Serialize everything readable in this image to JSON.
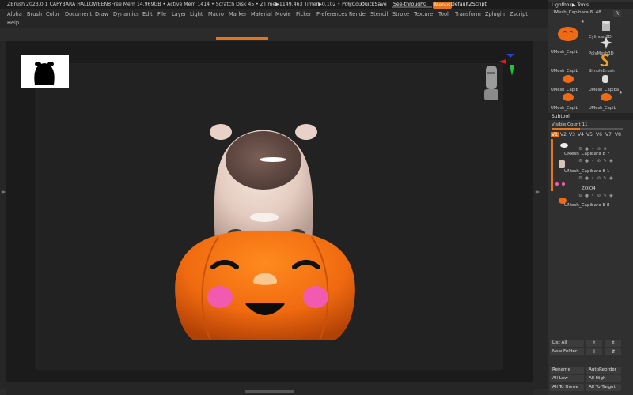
{
  "titlebar": {
    "app_title": "ZBrush 2023.0.1 CAPYBARA HALLOWEEN3",
    "mem_stats": "• Free Mem 14.969GB • Active Mem 1414 • Scratch Disk 45 • ZTime▶1149.463 Timer▶0.102 • PolyCour",
    "ac": "AC",
    "quicksave": "QuickSave",
    "seethrough_label": "See-through",
    "seethrough_value": "0",
    "seethrough_level": 0,
    "menus": "Menus",
    "default_script": "DefaultZScript"
  },
  "menu": {
    "row1": [
      "Alpha",
      "Brush",
      "Color",
      "Document",
      "Draw",
      "Dynamics",
      "Edit",
      "File",
      "Layer",
      "Light",
      "Macro",
      "Marker",
      "Material",
      "Movie",
      "Picker",
      "Preferences",
      "Render",
      "Stencil",
      "Stroke",
      "Texture",
      "Tool",
      "Transform",
      "Zplugin",
      "Zscript"
    ],
    "help": "Help"
  },
  "colors": {
    "accent": "#e8741a",
    "panel": "#303030",
    "viewport": "#1b1b1b",
    "canvas": "#222222"
  },
  "lightbox": {
    "label": "Lightbox▶ Tools"
  },
  "current_tool": {
    "name": "UMesh_Capibara 8. 48",
    "button": "R"
  },
  "tools": [
    {
      "name": "UMesh_Capib",
      "badge": "4"
    },
    {
      "name": "Cylinder3D",
      "badge": ""
    },
    {
      "name": "PolyMesh3D",
      "badge": ""
    },
    {
      "name": "UMesh_Capib",
      "badge": ""
    },
    {
      "name": "SimpleBrush",
      "badge": ""
    },
    {
      "name": "UMesh_Capib",
      "badge": ""
    },
    {
      "name": "UMesh_Capiba",
      "badge": ""
    },
    {
      "name": "UMesh_Capib",
      "badge": ""
    },
    {
      "name": "UMesh_Capib",
      "badge": "4"
    }
  ],
  "subtool": {
    "header": "Subtool",
    "visible_count": "Visible Count 11",
    "visible_tabs": [
      "V1",
      "V2",
      "V3",
      "V4",
      "V5",
      "V6",
      "V7",
      "V8"
    ],
    "items": [
      {
        "name": ""
      },
      {
        "name": "UMesh_Capibara 8 7"
      },
      {
        "name": "UMesh_Capibara 8 1"
      },
      {
        "name": "ZOIO4"
      },
      {
        "name": "UMesh_Capibara 8 8"
      }
    ]
  },
  "buttons": {
    "list_all": "List All",
    "new_folder": "New Folder",
    "rename": "Rename",
    "auto_reorder": "AutoReorder",
    "all_low": "All Low",
    "all_high": "All High",
    "all_to_home": "All To Home",
    "all_to_target": "All To Target"
  }
}
